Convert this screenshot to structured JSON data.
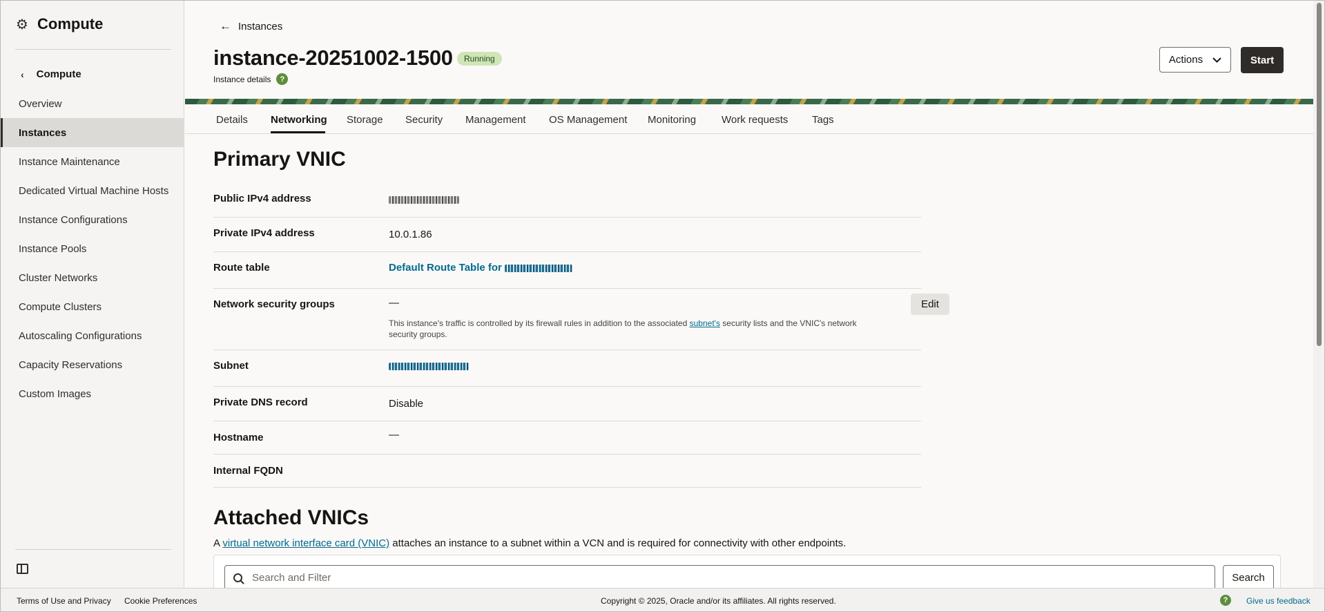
{
  "sidebar": {
    "title": "Compute",
    "back_label": "Compute",
    "items": [
      {
        "label": "Overview"
      },
      {
        "label": "Instances",
        "active": true
      },
      {
        "label": "Instance Maintenance"
      },
      {
        "label": "Dedicated Virtual Machine Hosts"
      },
      {
        "label": "Instance Configurations"
      },
      {
        "label": "Instance Pools"
      },
      {
        "label": "Cluster Networks"
      },
      {
        "label": "Compute Clusters"
      },
      {
        "label": "Autoscaling Configurations"
      },
      {
        "label": "Capacity Reservations"
      },
      {
        "label": "Custom Images"
      }
    ]
  },
  "header": {
    "breadcrumb": "Instances",
    "title": "instance-20251002-1500",
    "status": "Running",
    "subtitle": "Instance details",
    "actions_label": "Actions",
    "start_label": "Start"
  },
  "tabs": [
    "Details",
    "Networking",
    "Storage",
    "Security",
    "Management",
    "OS Management",
    "Monitoring",
    "Work requests",
    "Tags"
  ],
  "active_tab": "Networking",
  "primary_vnic": {
    "title": "Primary VNIC",
    "rows": {
      "public_ip": {
        "label": "Public IPv4 address"
      },
      "private_ip": {
        "label": "Private IPv4 address",
        "value": "10.0.1.86"
      },
      "route_table": {
        "label": "Route table",
        "value_prefix": "Default Route Table for"
      },
      "nsg": {
        "label": "Network security groups",
        "value": "—",
        "edit_label": "Edit",
        "help_pre": "This instance's traffic is controlled by its firewall rules in addition to the associated",
        "help_link": "subnet's",
        "help_post": "security lists and the VNIC's network security groups."
      },
      "subnet": {
        "label": "Subnet"
      },
      "private_dns": {
        "label": "Private DNS record",
        "value": "Disable"
      },
      "hostname": {
        "label": "Hostname",
        "value": "—"
      },
      "fqdn": {
        "label": "Internal FQDN"
      }
    }
  },
  "attached_vnics": {
    "title": "Attached VNICs",
    "desc_pre": "A",
    "desc_link": "virtual network interface card (VNIC)",
    "desc_post": "attaches an instance to a subnet within a VCN and is required for connectivity with other endpoints.",
    "search_placeholder": "Search and Filter",
    "search_label": "Search"
  },
  "footer": {
    "terms": "Terms of Use and Privacy",
    "cookies": "Cookie Preferences",
    "copyright": "Copyright © 2025, Oracle and/or its affiliates. All rights reserved.",
    "feedback": "Give us feedback"
  },
  "icons": {
    "sidebar_header": "gear-icon",
    "back": "chevron-left-icon",
    "breadcrumb": "arrow-left-icon",
    "help": "help-icon",
    "actions": "chevron-down-icon",
    "search": "search-icon",
    "collapse": "sidebar-collapse-icon"
  },
  "colors": {
    "link": "#006b8f",
    "status_bg": "#cfe5b8",
    "primary_button": "#2f2b28",
    "help_icon": "#5d8d3e"
  }
}
